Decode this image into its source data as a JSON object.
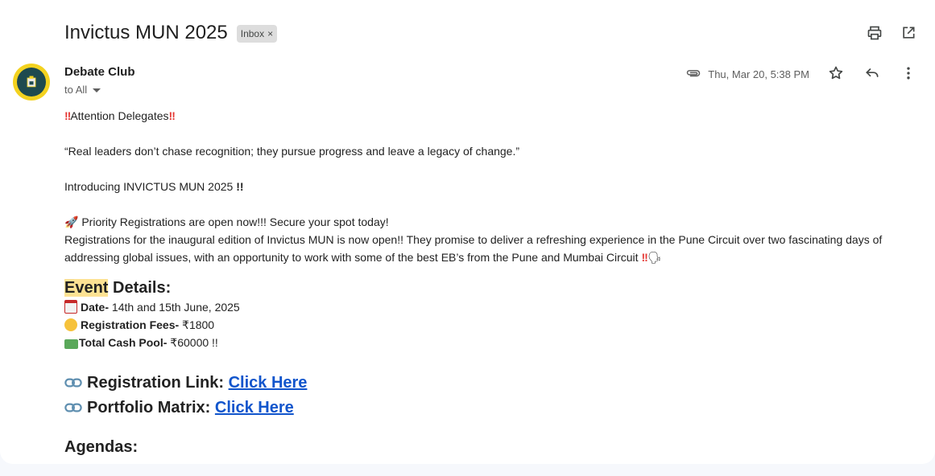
{
  "subject": "Invictus MUN 2025",
  "label_chip": {
    "text": "Inbox",
    "remove": "×"
  },
  "sender": {
    "name": "Debate Club",
    "to": "to All"
  },
  "timestamp": "Thu, Mar 20, 5:38 PM",
  "body": {
    "attention": "Attention Delegates",
    "quote": "“Real leaders don’t chase recognition; they pursue progress and leave a legacy of change.”",
    "intro": "Introducing INVICTUS MUN 2025",
    "priority": "Priority Registrations are open now!!! Secure your spot today!",
    "para": "Registrations for the inaugural edition of Invictus MUN is now open!! They promise to deliver a refreshing experience in the Pune Circuit over two fascinating days of addressing global issues, with an opportunity to work with some of the best EB’s from the Pune and Mumbai Circuit",
    "details_heading_hl": "Event",
    "details_heading_rest": " Details:",
    "date_label": "Date-",
    "date_value": " 14th and 15th June, 2025",
    "fees_label": "Registration Fees-",
    "fees_value": " ₹1800",
    "pool_label": "Total Cash Pool-",
    "pool_value": " ₹60000 !!",
    "reg_link_label": "Registration Link: ",
    "reg_link_text": "Click Here",
    "portfolio_label": "Portfolio Matrix: ",
    "portfolio_link_text": "Click Here",
    "agendas": "Agendas:"
  },
  "colors": {
    "link": "#1155cc",
    "highlight": "#fde293",
    "chip_bg": "#dddddd"
  },
  "icons": [
    "print-icon",
    "open-in-new-icon",
    "attachment-icon",
    "star-icon",
    "reply-icon",
    "more-vert-icon"
  ]
}
